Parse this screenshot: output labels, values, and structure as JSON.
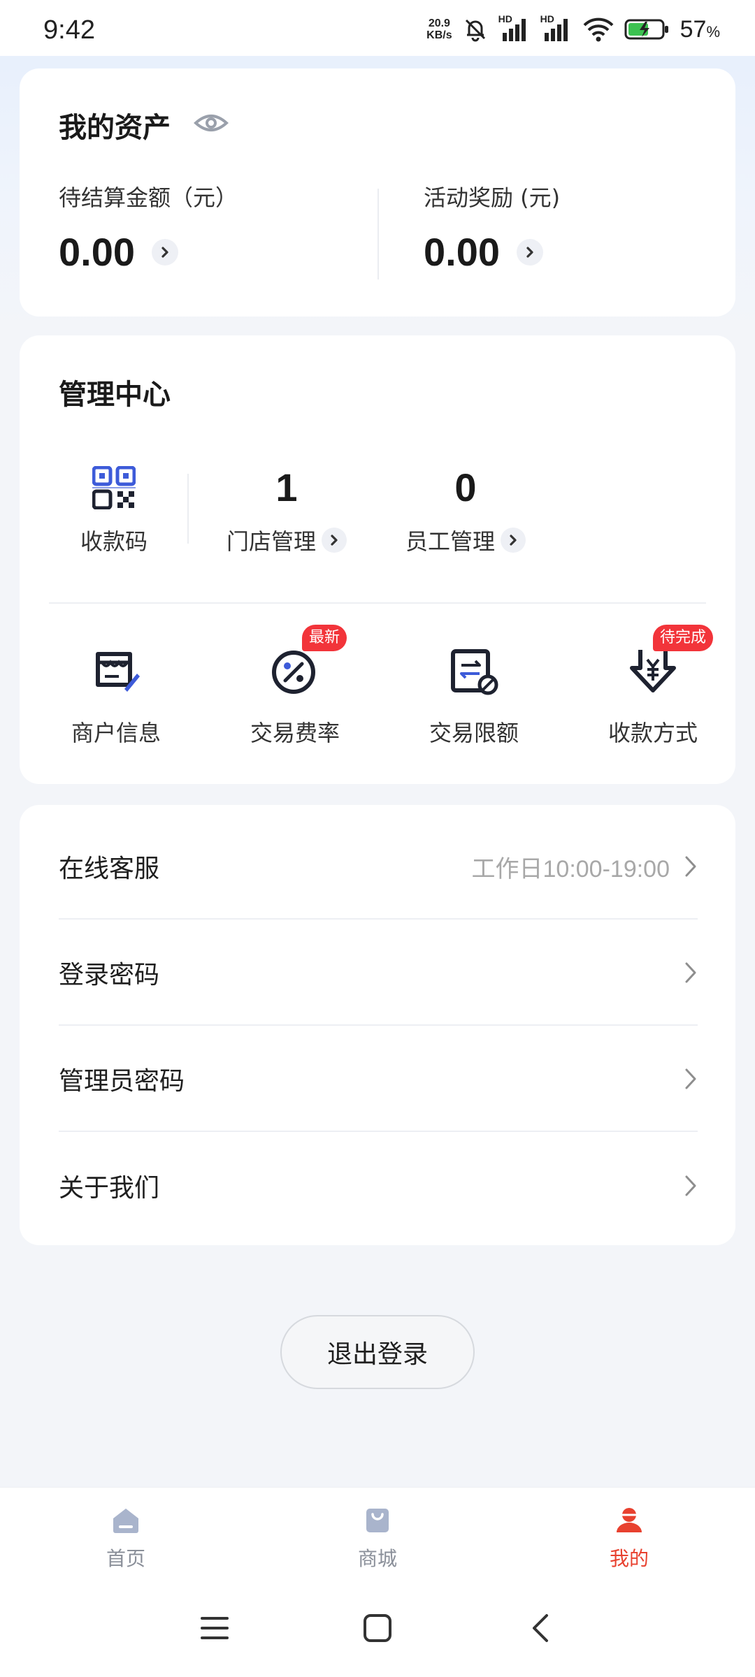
{
  "status_bar": {
    "time": "9:42",
    "net_speed_value": "20.9",
    "net_speed_unit": "KB/s",
    "hd_label": "HD",
    "battery_percent": "57",
    "percent_sign": "%"
  },
  "assets": {
    "title": "我的资产",
    "pending": {
      "label": "待结算金额（元）",
      "value": "0.00"
    },
    "reward": {
      "label": "活动奖励 (元)",
      "value": "0.00"
    }
  },
  "management": {
    "title": "管理中心",
    "qr": {
      "label": "收款码",
      "icon": "qr-code-icon"
    },
    "store": {
      "count": "1",
      "label": "门店管理"
    },
    "staff": {
      "count": "0",
      "label": "员工管理"
    },
    "functions": [
      {
        "label": "商户信息",
        "icon": "merchant-info-icon",
        "badge": ""
      },
      {
        "label": "交易费率",
        "icon": "fee-rate-icon",
        "badge": "最新"
      },
      {
        "label": "交易限额",
        "icon": "trade-limit-icon",
        "badge": ""
      },
      {
        "label": "收款方式",
        "icon": "payment-method-icon",
        "badge": "待完成"
      }
    ]
  },
  "menu": [
    {
      "label": "在线客服",
      "hint": "工作日10:00-19:00"
    },
    {
      "label": "登录密码",
      "hint": ""
    },
    {
      "label": "管理员密码",
      "hint": ""
    },
    {
      "label": "关于我们",
      "hint": ""
    }
  ],
  "logout_label": "退出登录",
  "bottom_nav": [
    {
      "label": "首页",
      "icon": "home-icon"
    },
    {
      "label": "商城",
      "icon": "mall-bag-icon"
    },
    {
      "label": "我的",
      "icon": "profile-icon"
    }
  ],
  "colors": {
    "accent_red": "#E8412F",
    "badge_red": "#F2343A",
    "qr_blue": "#3D5BD9",
    "inactive_nav": "#A9B4CC"
  }
}
